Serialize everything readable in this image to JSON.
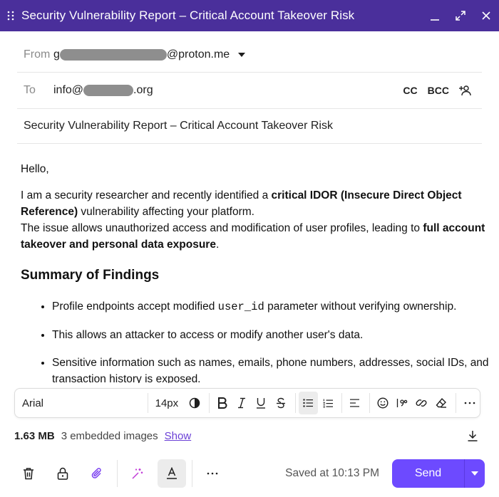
{
  "window": {
    "title": "Security Vulnerability Report – Critical Account Takeover Risk"
  },
  "header": {
    "from_label": "From",
    "from_prefix": "g",
    "from_suffix": "@proton.me",
    "to_label": "To",
    "to_prefix": "info@",
    "to_suffix": ".org",
    "cc_label": "CC",
    "bcc_label": "BCC",
    "subject": "Security Vulnerability Report – Critical Account Takeover Risk"
  },
  "body": {
    "greeting": "Hello,",
    "p1_a": "I am a security researcher and recently identified a ",
    "p1_b": "critical IDOR (Insecure Direct Object Reference)",
    "p1_c": " vulnerability affecting your platform.",
    "p2_a": "The issue allows unauthorized access and modification of user profiles, leading to ",
    "p2_b": "full account takeover and personal data exposure",
    "p2_c": ".",
    "heading": "Summary of Findings",
    "li1_a": "Profile endpoints accept modified ",
    "li1_code": "user_id",
    "li1_b": " parameter without verifying ownership.",
    "li2": "This allows an attacker to access or modify another user's data.",
    "li3": "Sensitive information such as names, emails, phone numbers, addresses, social IDs, and transaction history is exposed."
  },
  "toolbar": {
    "font": "Arial",
    "size": "14px"
  },
  "attachments": {
    "size": "1.63 MB",
    "count": "3 embedded images",
    "show": "Show"
  },
  "footer": {
    "saved": "Saved at 10:13 PM",
    "send": "Send"
  },
  "colors": {
    "titlebar": "#4a2f9b",
    "accent": "#6d4aff",
    "link": "#6a3fd6"
  }
}
